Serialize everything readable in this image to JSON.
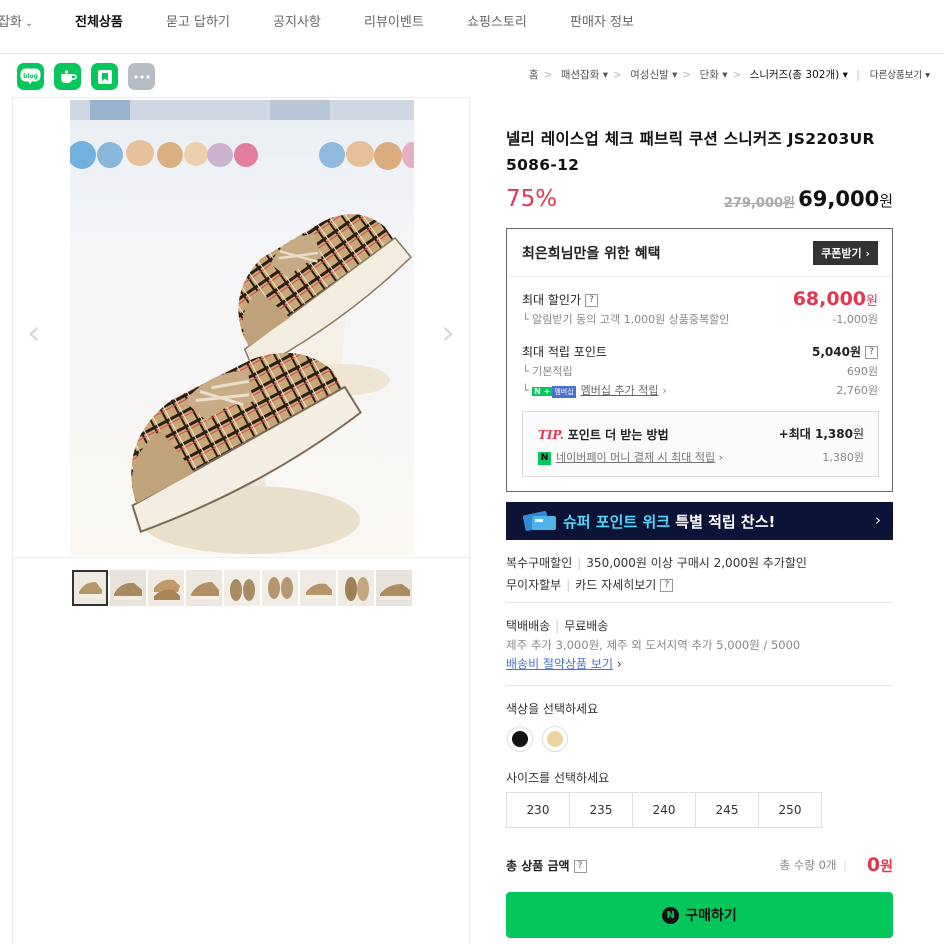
{
  "nav": {
    "items": [
      {
        "label": "잡화",
        "chevron": true
      },
      {
        "label": "전체상품",
        "active": true
      },
      {
        "label": "묻고 답하기"
      },
      {
        "label": "공지사항"
      },
      {
        "label": "리뷰이벤트"
      },
      {
        "label": "쇼핑스토리"
      },
      {
        "label": "판매자 정보"
      }
    ]
  },
  "share": {
    "blog": "blog",
    "icons": [
      "blog-share-icon",
      "cafe-share-icon",
      "bookmark-share-icon",
      "more-share-icon"
    ]
  },
  "breadcrumb": {
    "home": "홈",
    "c1": "패션잡화",
    "c2": "여성신발",
    "c3": "단화",
    "current": "스니커즈(총 302개)",
    "other": "다른상품보기"
  },
  "product": {
    "title": "넬리 레이스업 체크 패브릭 쿠션 스니커즈 JS2203UR 5086-12",
    "discount": "75%",
    "original_price": "279,000원",
    "price_number": "69,000",
    "price_unit": "원"
  },
  "benefit": {
    "heading": "최은희님만을 위한 혜택",
    "coupon_label": "쿠폰받기",
    "max_sale_label": "최대 할인가",
    "max_sale_number": "68,000",
    "max_sale_unit": "원",
    "alarm_label": "알림받기 동의 고객 1,000원 상품중복할인",
    "alarm_value": "-1,000원",
    "max_point_label": "최대 적립 포인트",
    "max_point_value": "5,040원",
    "basic_label": "기본적립",
    "basic_value": "690원",
    "member_badge": "멤버십",
    "member_label": "멤버십 추가 적립",
    "member_value": "2,760원",
    "tip_word": "TIP.",
    "tip_title": "포인트 더 받는 방법",
    "tip_max_prefix": "+최대",
    "tip_max_value": "1,380",
    "tip_max_unit": "원",
    "npay_label": "네이버페이 머니 결제 시 최대 적립",
    "npay_value": "1,380원"
  },
  "banner": {
    "highlight": "슈퍼 포인트 위크",
    "text": "특별 적립 찬스!"
  },
  "purchase_info": {
    "multi_label": "복수구매할인",
    "multi_value": "350,000원 이상 구매시 2,000원 추가할인",
    "installment": "무이자할부",
    "card_detail": "카드 자세히보기"
  },
  "shipping": {
    "method": "택배배송",
    "fee": "무료배송",
    "extra": "제주 추가 3,000원, 제주 외 도서지역 추가 5,000원 / 5000",
    "saver_link": "배송비 절약상품 보기"
  },
  "options": {
    "color_label": "색상을 선택하세요",
    "colors": [
      "#111111",
      "#ecd49c"
    ],
    "size_label": "사이즈를 선택하세요",
    "sizes": [
      "230",
      "235",
      "240",
      "245",
      "250"
    ]
  },
  "total": {
    "label": "총 상품 금액",
    "count": "총 수량 0개",
    "amount_number": "0",
    "amount_unit": "원"
  },
  "buy": {
    "label": "구매하기"
  },
  "colors": {
    "naver_green": "#03c75a",
    "sale_red": "#e2374f",
    "banner_navy": "#0d1337"
  }
}
